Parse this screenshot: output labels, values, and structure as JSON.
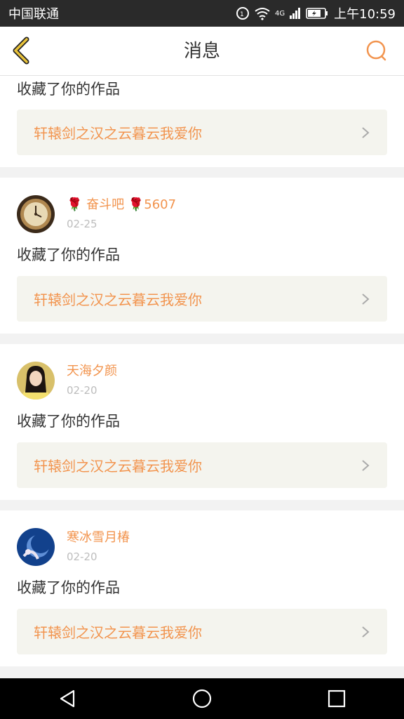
{
  "status_bar": {
    "carrier": "中国联通",
    "network": "4G",
    "time": "上午10:59"
  },
  "header": {
    "title": "消息",
    "accent_color": "#f2944e"
  },
  "partial_item": {
    "action": "收藏了你的作品",
    "work_title": "轩辕剑之汉之云暮云我爱你"
  },
  "items": [
    {
      "user": "🌹 奋斗吧 🌹5607",
      "date": "02-25",
      "action": "收藏了你的作品",
      "work_title": "轩辕剑之汉之云暮云我爱你",
      "avatar": "clock-avatar"
    },
    {
      "user": "天海夕颜",
      "date": "02-20",
      "action": "收藏了你的作品",
      "work_title": "轩辕剑之汉之云暮云我爱你",
      "avatar": "portrait-avatar"
    },
    {
      "user": "寒冰雪月椿",
      "date": "02-20",
      "action": "收藏了你的作品",
      "work_title": "轩辕剑之汉之云暮云我爱你",
      "avatar": "moon-avatar"
    }
  ]
}
